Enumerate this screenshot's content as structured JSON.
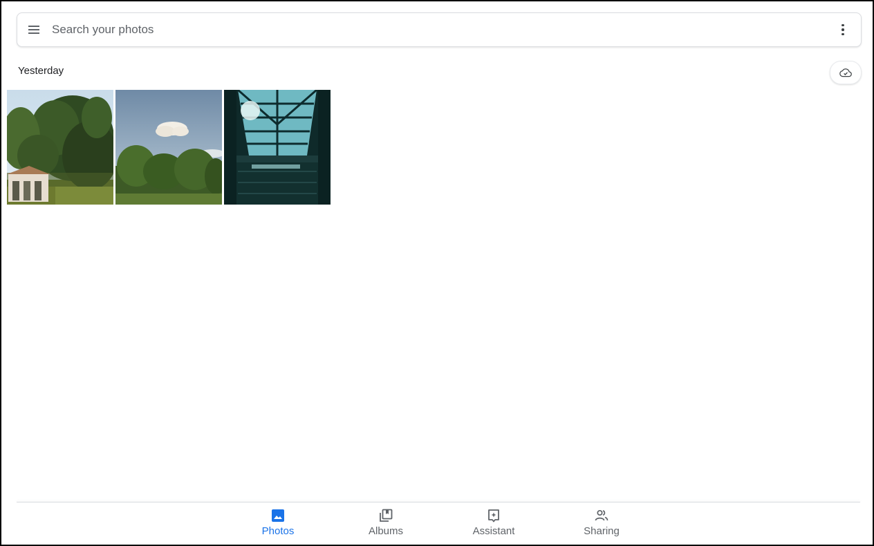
{
  "search": {
    "placeholder": "Search your photos"
  },
  "section": {
    "title": "Yesterday"
  },
  "photos": [
    {
      "name": "trees-gazebo"
    },
    {
      "name": "sky-cloud-trees"
    },
    {
      "name": "glass-skylight-roof"
    }
  ],
  "nav": {
    "items": [
      {
        "label": "Photos",
        "icon": "photo-icon",
        "active": true
      },
      {
        "label": "Albums",
        "icon": "album-icon",
        "active": false
      },
      {
        "label": "Assistant",
        "icon": "assistant-icon",
        "active": false
      },
      {
        "label": "Sharing",
        "icon": "people-icon",
        "active": false
      }
    ]
  },
  "colors": {
    "accent": "#1a73e8",
    "icon_gray": "#5f6368",
    "text": "#202124"
  }
}
